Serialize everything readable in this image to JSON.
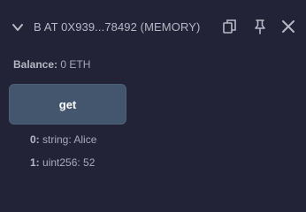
{
  "contract": {
    "title": "B AT 0X939...78492 (MEMORY)"
  },
  "icons": {
    "chevron": "chevron-down-icon",
    "copy": "copy-icon",
    "pin": "pin-icon",
    "close": "close-icon"
  },
  "balance": {
    "label": "Balance:",
    "value": "0 ETH"
  },
  "function": {
    "button_label": "get"
  },
  "outputs": [
    {
      "index": "0:",
      "value": "string: Alice"
    },
    {
      "index": "1:",
      "value": "uint256: 52"
    }
  ],
  "colors": {
    "background": "#222336",
    "button": "#43566d"
  }
}
